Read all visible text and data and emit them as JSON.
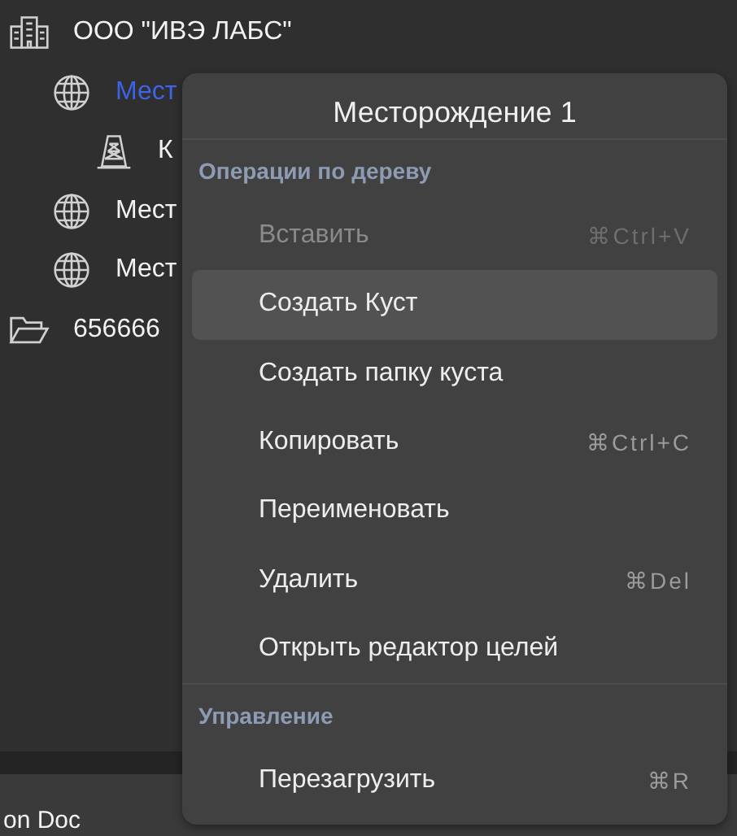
{
  "tree": [
    {
      "label": "ООО \"ИВЭ ЛАБС\"",
      "kind": "building",
      "selected": false,
      "children": [
        {
          "label": "Мест",
          "kind": "globe",
          "selected": true,
          "children": [
            {
              "label": "К",
              "kind": "derrick",
              "selected": false
            }
          ]
        },
        {
          "label": "Мест",
          "kind": "globe",
          "selected": false
        },
        {
          "label": "Мест",
          "kind": "globe",
          "selected": false
        }
      ]
    },
    {
      "label": "656666",
      "kind": "folder",
      "selected": false
    }
  ],
  "context_menu": {
    "title": "Месторождение 1",
    "sections": [
      {
        "header": "Операции по дереву",
        "items": [
          {
            "label": "Вставить",
            "shortcut": "⌘Ctrl+V",
            "disabled": true,
            "hovered": false
          },
          {
            "label": "Создать Куст",
            "disabled": false,
            "hovered": true
          },
          {
            "label": "Создать папку куста",
            "disabled": false,
            "hovered": false
          },
          {
            "label": "Копировать",
            "shortcut": "⌘Ctrl+C",
            "disabled": false,
            "hovered": false
          },
          {
            "label": "Переименовать",
            "disabled": false,
            "hovered": false
          },
          {
            "label": "Удалить",
            "shortcut": "⌘Del",
            "disabled": false,
            "hovered": false
          },
          {
            "label": "Открыть редактор целей",
            "disabled": false,
            "hovered": false
          }
        ]
      },
      {
        "header": "Управление",
        "items": [
          {
            "label": "Перезагрузить",
            "shortcut": "⌘R",
            "disabled": false,
            "hovered": false
          }
        ]
      }
    ]
  },
  "bottom_panel": {
    "text": "on Doc"
  }
}
